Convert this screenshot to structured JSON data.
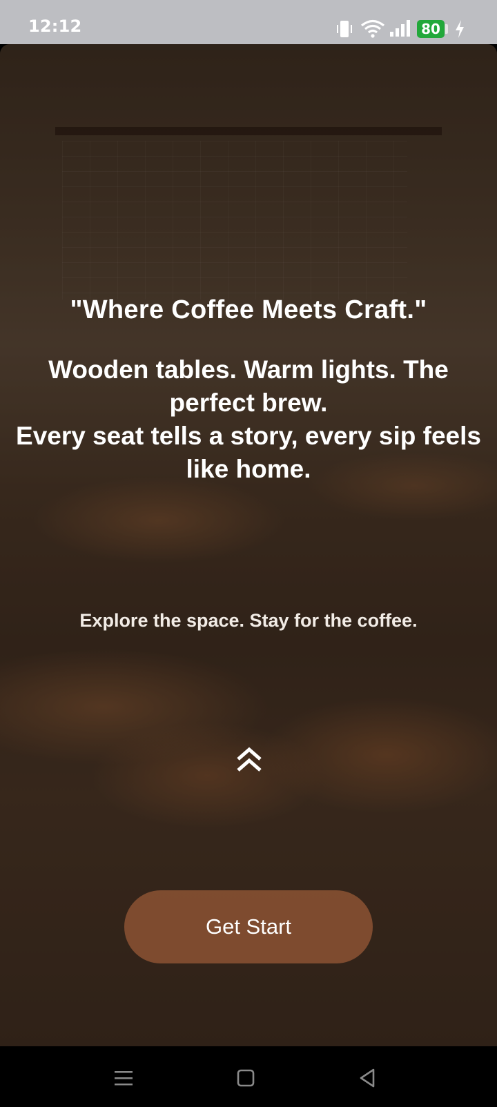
{
  "status_bar": {
    "time": "12:12",
    "battery_level": "80",
    "icons": [
      "vibrate-icon",
      "wifi-icon",
      "signal-icon",
      "battery-icon",
      "charging-icon"
    ]
  },
  "hero": {
    "headline": "\"Where Coffee Meets Craft.\"",
    "body_line1": "Wooden tables. Warm lights. The perfect brew.",
    "body_line2": "Every seat tells a story, every sip feels like home.",
    "tagline": "Explore the space. Stay for the coffee.",
    "scroll_icon": "double-chevron-up-icon",
    "cta_label": "Get Start"
  },
  "nav_bar": {
    "icons": [
      "menu-icon",
      "home-icon",
      "back-icon"
    ]
  },
  "colors": {
    "battery": "#22a83a",
    "cta_background": "#ad643e",
    "status_bar_bg": "#bdbec2"
  }
}
